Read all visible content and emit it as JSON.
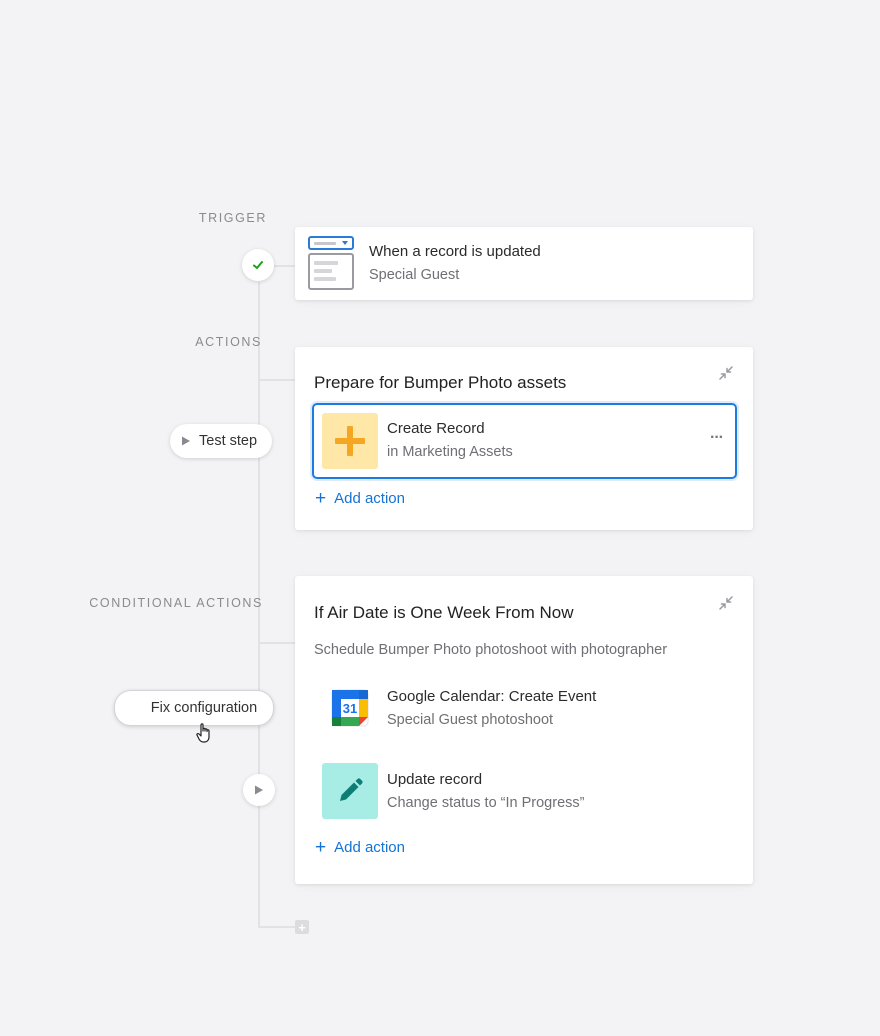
{
  "trigger": {
    "section_label": "TRIGGER",
    "title": "When a record is updated",
    "subtitle": "Special Guest",
    "icon": "form-record-icon"
  },
  "actions": {
    "section_label": "ACTIONS",
    "group_title": "Prepare for Bumper Photo assets",
    "test_step_label": "Test step",
    "items": [
      {
        "title": "Create Record",
        "subtitle": "in Marketing Assets",
        "icon": "plus-icon",
        "more_label": "···"
      }
    ],
    "add_action_label": "Add action"
  },
  "conditional": {
    "section_label": "CONDITIONAL ACTIONS",
    "group_title": "If Air Date is One Week From Now",
    "description": "Schedule Bumper Photo photoshoot with photographer",
    "fix_config_label": "Fix configuration",
    "items": [
      {
        "title": "Google Calendar: Create Event",
        "subtitle": "Special Guest photoshoot",
        "icon": "google-calendar-icon",
        "icon_text": "31"
      },
      {
        "title": "Update record",
        "subtitle": "Change status to “In Progress”",
        "icon": "pencil-icon"
      }
    ],
    "add_action_label": "Add action"
  },
  "colors": {
    "accent": "#1573d6",
    "check": "#1aa31a",
    "create_record_bg": "#ffe7a8",
    "create_record_plus": "#f5a623",
    "update_record_bg": "#a8ece6",
    "update_record_pencil": "#0e7d74"
  }
}
